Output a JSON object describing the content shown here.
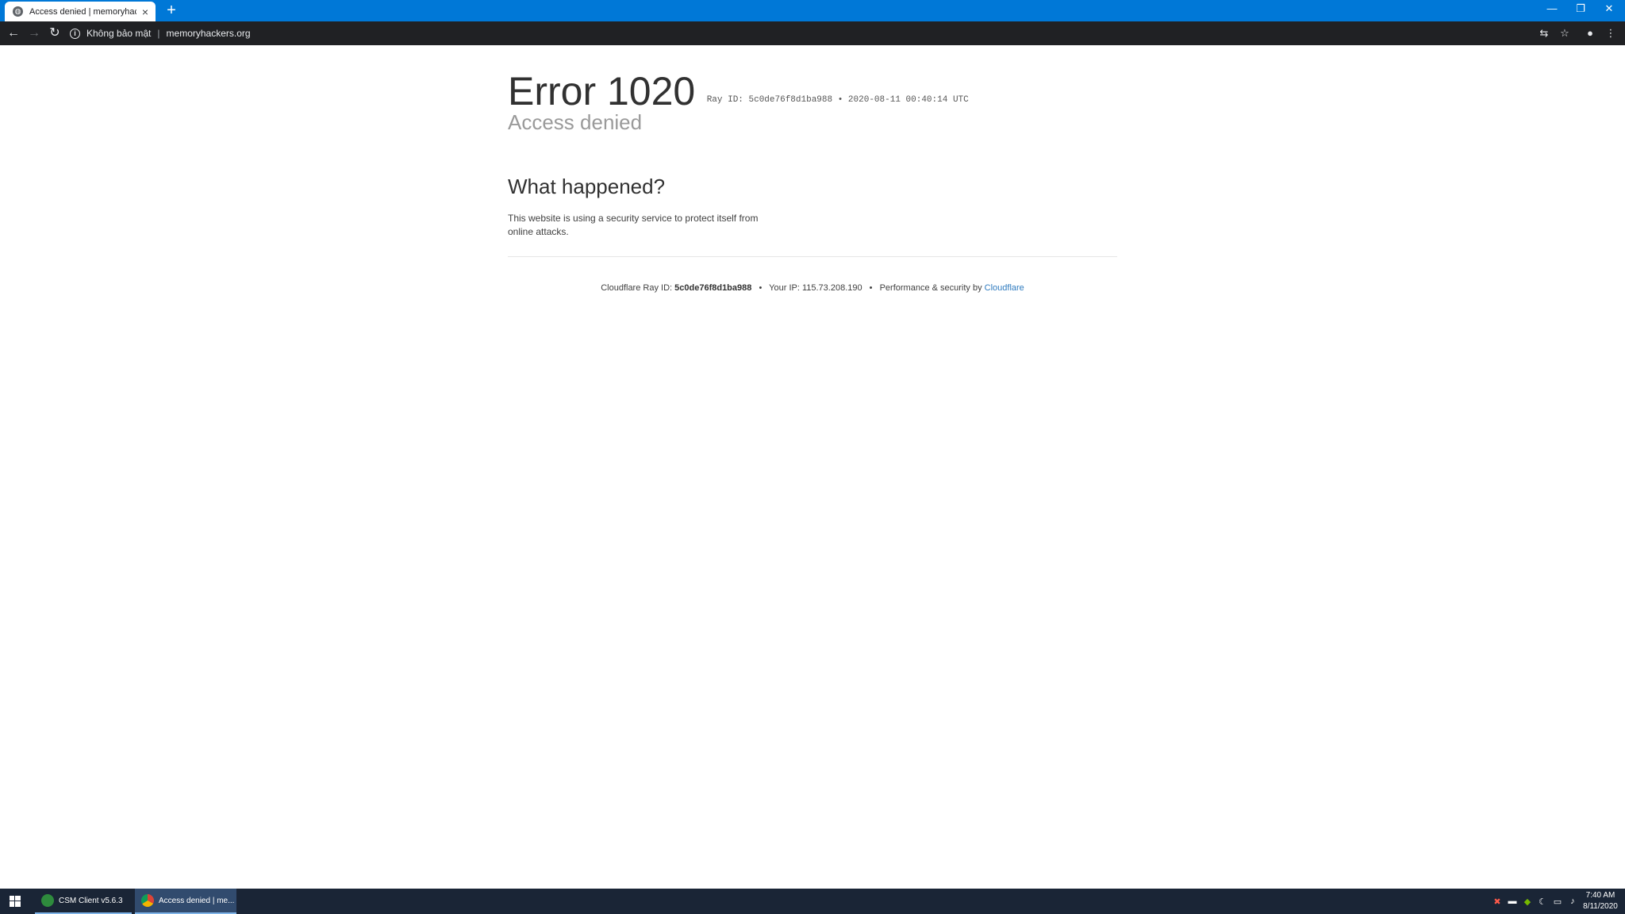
{
  "browser": {
    "tab": {
      "title": "Access denied | memoryhackers.org"
    },
    "new_tab_symbol": "+",
    "window_controls": {
      "minimize": "—",
      "restore": "❐",
      "close": "✕"
    },
    "nav": {
      "back": "←",
      "forward": "→",
      "reload": "↻"
    },
    "omnibox": {
      "security_label": "Không bảo mật",
      "url": "memoryhackers.org"
    },
    "toolbar_icons": [
      "translate-icon",
      "star-icon",
      "profile-icon",
      "menu-icon"
    ]
  },
  "page": {
    "error_title": "Error 1020",
    "ray_header": "Ray ID: 5c0de76f8d1ba988 • 2020-08-11 00:40:14 UTC",
    "subtitle": "Access denied",
    "section_heading": "What happened?",
    "explanation": "This website is using a security service to protect itself from online attacks.",
    "footer": {
      "ray_label": "Cloudflare Ray ID:",
      "ray_id": "5c0de76f8d1ba988",
      "ip_label": "Your IP:",
      "ip": "115.73.208.190",
      "perf_label": "Performance & security by",
      "cloudflare_link": "Cloudflare",
      "bullet": "•"
    }
  },
  "taskbar": {
    "apps": [
      {
        "label": "CSM Client v5.6.3",
        "icon": "csm-icon"
      },
      {
        "label": "Access denied | me...",
        "icon": "chrome-icon"
      }
    ],
    "clock": {
      "time": "7:40 AM",
      "date": "8/11/2020"
    }
  },
  "colors": {
    "titlebar": "#0078d7",
    "toolbar": "#202124",
    "taskbar": "#1a2536",
    "link": "#2f7bbf"
  }
}
